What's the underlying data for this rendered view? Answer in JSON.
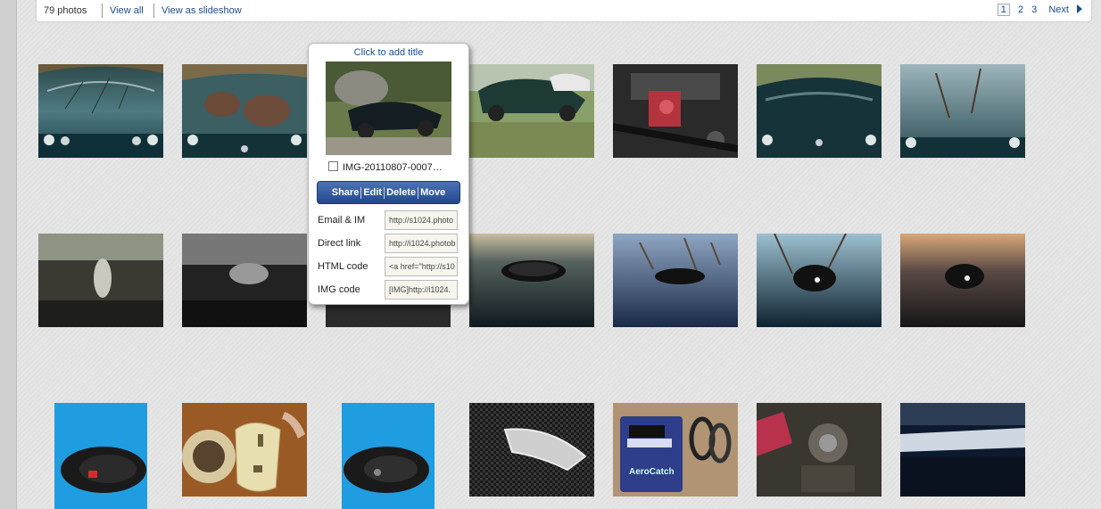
{
  "topbar": {
    "photo_count": "79 photos",
    "view_all": "View all",
    "view_slideshow": "View as slideshow",
    "pages": [
      "1",
      "2",
      "3"
    ],
    "current_page": "1",
    "next": "Next"
  },
  "popup": {
    "title": "Click to add title",
    "filename": "IMG-20110807-0007…",
    "actions": [
      "Share",
      "Edit",
      "Delete",
      "Move"
    ],
    "codes": [
      {
        "label": "Email & IM",
        "value": "http://s1024.photo"
      },
      {
        "label": "Direct link",
        "value": "http://i1024.photob"
      },
      {
        "label": "HTML code",
        "value": "<a href=\"http://s10"
      },
      {
        "label": "IMG code",
        "value": "[IMG]http://i1024."
      }
    ]
  },
  "thumbnails": {
    "row1": [
      "green car hood front",
      "hood with dark patches",
      "car parked on grass",
      "engine bay red part",
      "car front view",
      "hood reflection"
    ],
    "row2": [
      "hood scoop closeup",
      "hood scoop dark",
      "hood pin black",
      "hood pin reflection",
      "hood pin closeup",
      "hood pin sunset"
    ],
    "row3": [
      "hood pin on blue",
      "aerocatch box with emblem",
      "hood pin on blue 2",
      "carbon hood pin",
      "aerocatch package",
      "engine hoses",
      "hood edge"
    ]
  }
}
